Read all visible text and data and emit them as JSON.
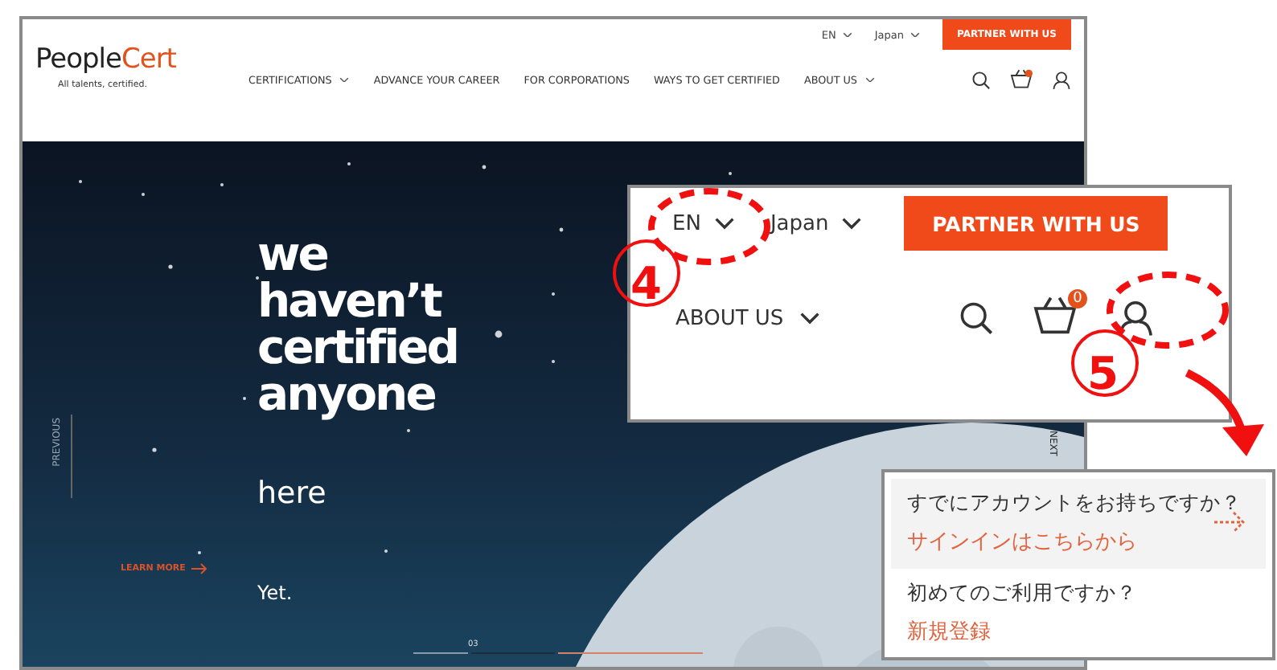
{
  "header": {
    "logo_primary": "People",
    "logo_accent": "Cert",
    "tagline": "All talents, certified.",
    "language": "EN",
    "country": "Japan",
    "partner_button": "PARTNER WITH US",
    "nav": [
      {
        "label": "CERTIFICATIONS",
        "dropdown": true
      },
      {
        "label": "ADVANCE YOUR CAREER",
        "dropdown": false
      },
      {
        "label": "FOR CORPORATIONS",
        "dropdown": false
      },
      {
        "label": "WAYS TO GET CERTIFIED",
        "dropdown": false
      },
      {
        "label": "ABOUT US",
        "dropdown": true
      }
    ]
  },
  "hero": {
    "headline": [
      "we",
      "haven’t",
      "certified",
      "anyone"
    ],
    "subline": "here",
    "tail": "Yet.",
    "learn_more": "LEARN MORE",
    "previous": "PREVIOUS",
    "next": "NEXT",
    "slide_number": "03"
  },
  "zoom_inset": {
    "language": "EN",
    "country": "Japan",
    "partner_button": "PARTNER WITH US",
    "nav_item": "ABOUT US",
    "cart_count": "0"
  },
  "account_popup": {
    "items": [
      {
        "question": "すでにアカウントをお持ちですか？",
        "link": "サインインはこちらから",
        "highlighted": true
      },
      {
        "question": "初めてのご利用ですか？",
        "link": "新規登録",
        "highlighted": false
      }
    ]
  },
  "annotations": [
    {
      "number": "4"
    },
    {
      "number": "5"
    }
  ]
}
